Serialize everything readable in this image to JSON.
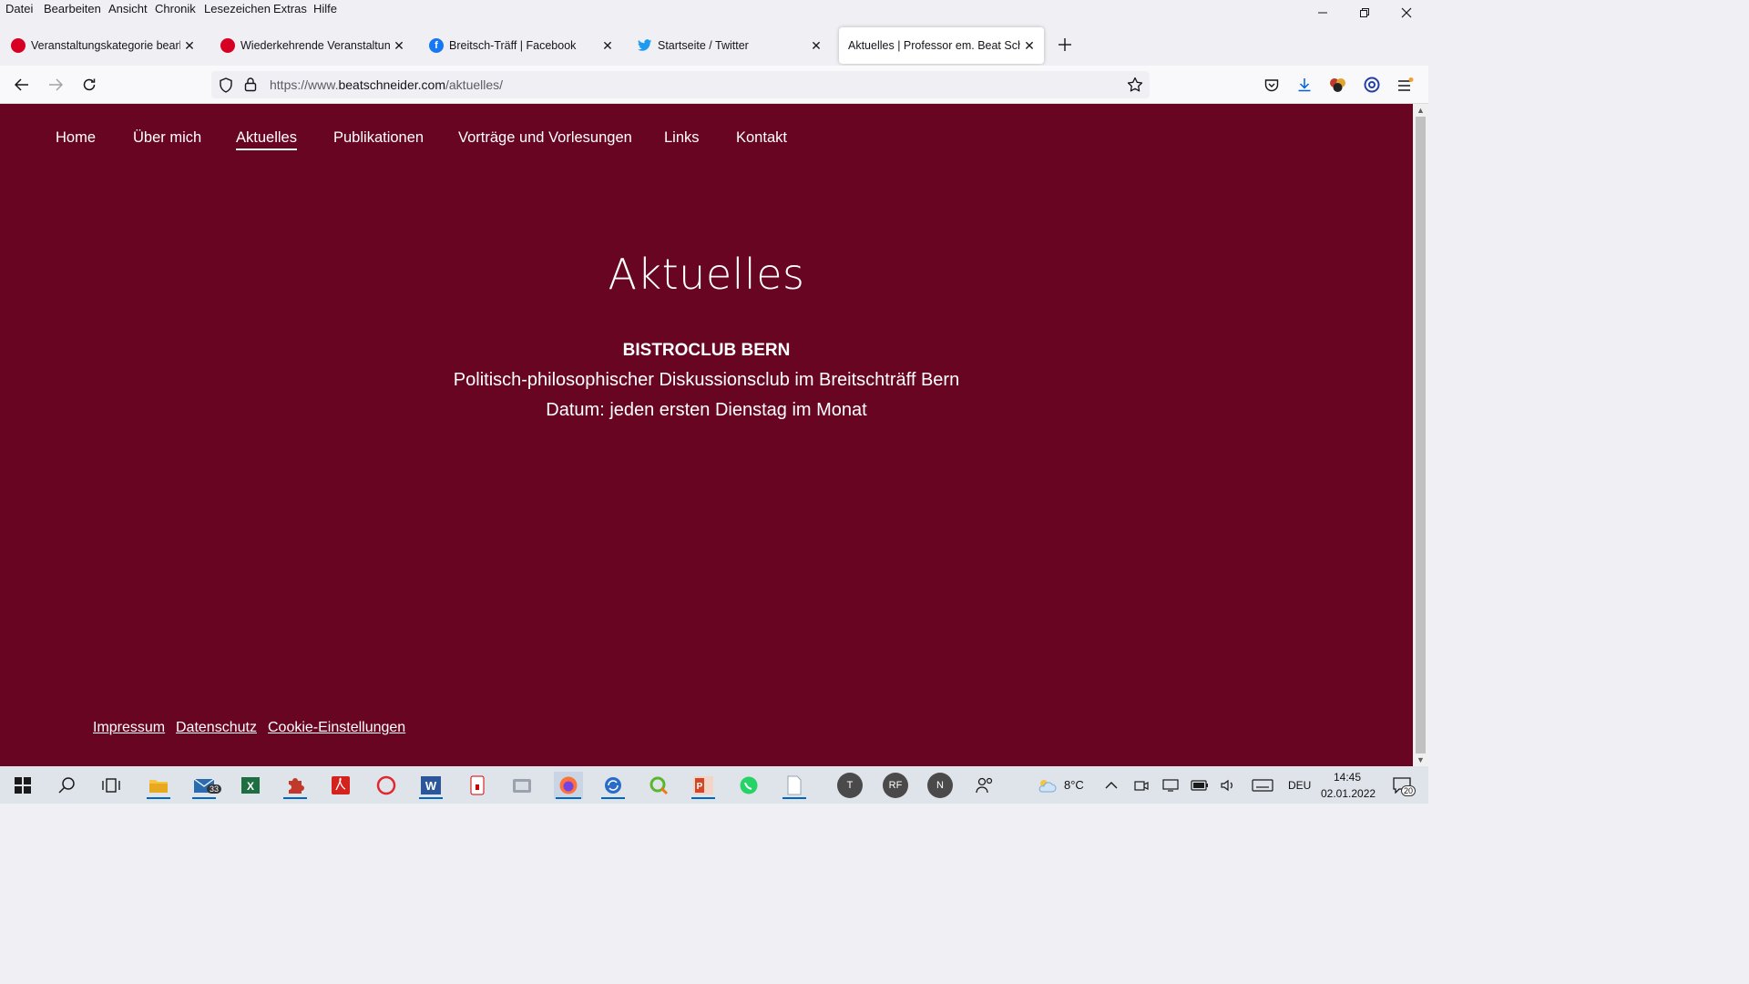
{
  "menubar": {
    "items": [
      "Datei",
      "Bearbeiten",
      "Ansicht",
      "Chronik",
      "Lesezeichen",
      "Extras",
      "Hilfe"
    ]
  },
  "tabs": [
    {
      "title": "Veranstaltungskategorie bearbe",
      "icon": "red-circle-icon",
      "active": false
    },
    {
      "title": "Wiederkehrende Veranstaltung",
      "icon": "red-circle-icon",
      "active": false
    },
    {
      "title": "Breitsch-Träff | Facebook",
      "icon": "facebook-icon",
      "active": false
    },
    {
      "title": "Startseite / Twitter",
      "icon": "twitter-icon",
      "active": false
    },
    {
      "title": "Aktuelles | Professor em. Beat Schne",
      "icon": "page-icon",
      "active": true
    }
  ],
  "address": {
    "prefix": "https://www.",
    "domain": "beatschneider.com",
    "path": "/aktuelles/"
  },
  "site": {
    "nav": [
      "Home",
      "Über mich",
      "Aktuelles",
      "Publikationen",
      "Vorträge und Vorlesungen",
      "Links",
      "Kontakt"
    ],
    "active_nav": "Aktuelles",
    "page_title": "Aktuelles",
    "event_title": "BISTROCLUB BERN",
    "event_desc": "Politisch-philosophischer Diskussionsclub im Breitschträff Bern",
    "event_date": "Datum: jeden ersten Dienstag im Monat",
    "footer": [
      "Impressum",
      "Datenschutz",
      "Cookie-Einstellungen"
    ],
    "bg_color": "#670522"
  },
  "taskbar": {
    "mail_badge": "33",
    "avatars": [
      "T",
      "RF",
      "N"
    ],
    "temperature": "8°C",
    "language": "DEU",
    "time": "14:45",
    "date": "02.01.2022",
    "notifications": "20"
  }
}
